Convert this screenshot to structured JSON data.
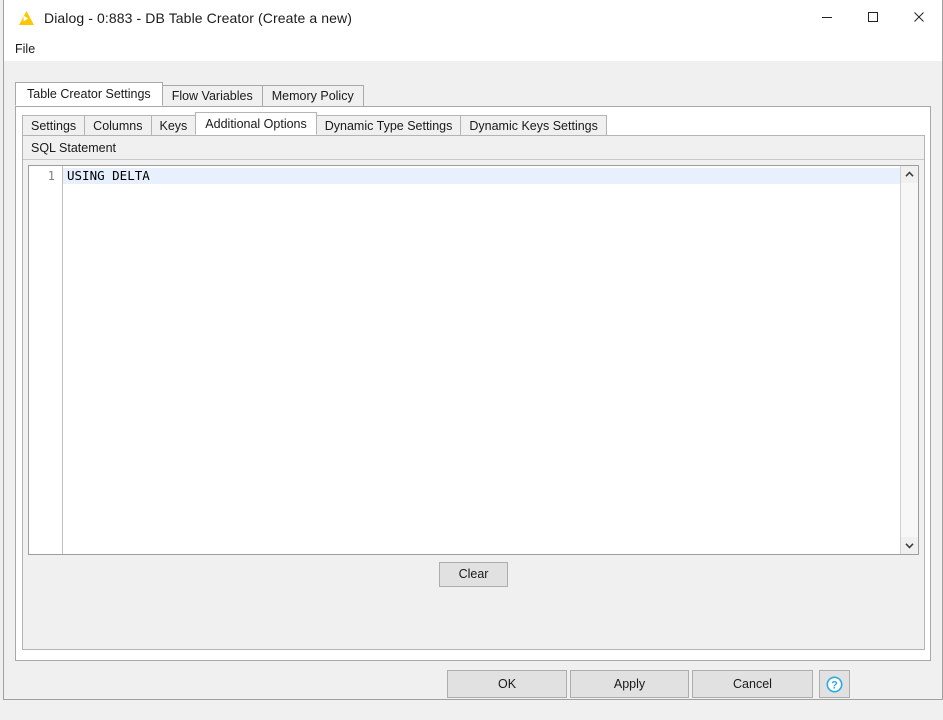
{
  "window": {
    "title": "Dialog - 0:883 - DB Table Creator (Create a new)",
    "app_icon": "knime-node-triangle-icon",
    "controls": {
      "minimize": "minimize-icon",
      "maximize": "maximize-icon",
      "close": "close-icon"
    }
  },
  "menubar": {
    "items": [
      {
        "label": "File"
      }
    ]
  },
  "outer_tabs": [
    {
      "label": "Table Creator Settings",
      "active": true
    },
    {
      "label": "Flow Variables",
      "active": false
    },
    {
      "label": "Memory Policy",
      "active": false
    }
  ],
  "inner_tabs": [
    {
      "label": "Settings",
      "active": false
    },
    {
      "label": "Columns",
      "active": false
    },
    {
      "label": "Keys",
      "active": false
    },
    {
      "label": "Additional Options",
      "active": true
    },
    {
      "label": "Dynamic Type Settings",
      "active": false
    },
    {
      "label": "Dynamic Keys Settings",
      "active": false
    }
  ],
  "sql_section": {
    "header": "SQL Statement",
    "editor": {
      "lines": [
        {
          "number": "1",
          "text": "USING DELTA",
          "current": true
        }
      ],
      "scrollbar": {
        "up_icon": "chevron-up-icon",
        "down_icon": "chevron-down-icon"
      }
    },
    "clear_label": "Clear"
  },
  "footer": {
    "ok_label": "OK",
    "apply_label": "Apply",
    "cancel_label": "Cancel",
    "help_icon": "help-circle-icon"
  },
  "colors": {
    "accent_yellow": "#FFD800",
    "help_blue": "#29ABE2",
    "dialog_bg": "#F0F0F0",
    "panel_bg": "#FFFFFF",
    "current_line": "#E8F0FD"
  }
}
